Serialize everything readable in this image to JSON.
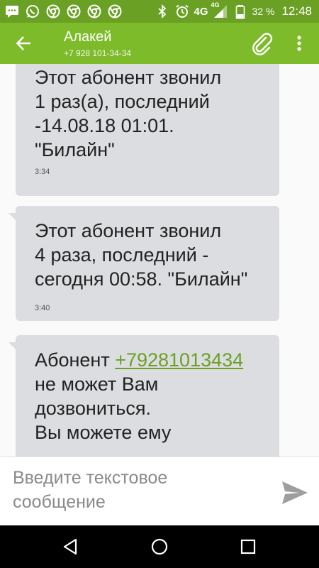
{
  "status_bar": {
    "notification_icons": [
      "message-icon",
      "whatsapp-icon",
      "chrome-icon",
      "chrome-icon",
      "chrome-icon",
      "chrome-icon"
    ],
    "network": "4G",
    "network_sup": "4G",
    "battery_percent": "32 %",
    "time": "12:48",
    "colors": {
      "background": "#6aa023"
    }
  },
  "app_bar": {
    "contact_name": "Алакей",
    "contact_number": "+7 928 101-34-34",
    "colors": {
      "background": "#7dbb2a"
    }
  },
  "messages": [
    {
      "lines": [
        "Этот абонент звонил",
        "1  раз(а), последний",
        "-14.08.18 01:01.",
        "\"Билайн\""
      ],
      "time": "3:34"
    },
    {
      "lines": [
        "Этот абонент звонил",
        "4 раза, последний -",
        "сегодня 00:58. \"Билайн\""
      ],
      "time": "3:40"
    },
    {
      "line1_prefix": "Абонент ",
      "phone_link": "+79281013434",
      "lines": [
        "не может Вам",
        "дозвониться.",
        "Вы можете ему"
      ]
    }
  ],
  "compose": {
    "placeholder": "Введите текстовое сообщение",
    "value": ""
  }
}
